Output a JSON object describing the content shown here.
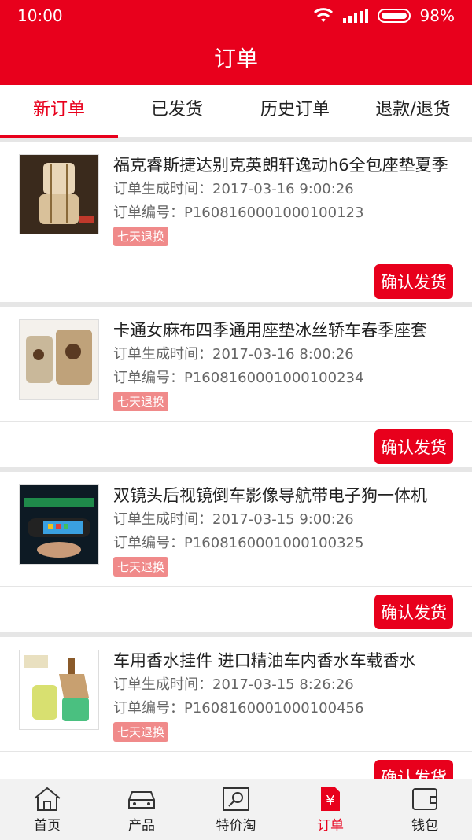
{
  "status": {
    "time": "10:00",
    "battery": "98%"
  },
  "header": {
    "title": "订单"
  },
  "tabs": [
    {
      "label": "新订单",
      "active": true
    },
    {
      "label": "已发货",
      "active": false
    },
    {
      "label": "历史订单",
      "active": false
    },
    {
      "label": "退款/退货",
      "active": false
    }
  ],
  "orders": [
    {
      "name": "福克睿斯捷达别克英朗轩逸动h6全包座垫夏季",
      "time_label": "订单生成时间：2017-03-16 9:00:26",
      "no_label": "订单编号：P160816000100010012 3",
      "tag": "七天退换",
      "button": "确认发货"
    },
    {
      "name": "卡通女麻布四季通用座垫冰丝轿车春季座套",
      "time_label": "订单生成时间：2017-03-16 8:00:26",
      "no_label": "订单编号：P1608160001000100234",
      "tag": "七天退换",
      "button": "确认发货"
    },
    {
      "name": "双镜头后视镜倒车影像导航带电子狗一体机",
      "time_label": "订单生成时间：2017-03-15 9:00:26",
      "no_label": "订单编号：P1608160001000100325",
      "tag": "七天退换",
      "button": "确认发货"
    },
    {
      "name": "车用香水挂件 进口精油车内香水车载香水",
      "time_label": "订单生成时间：2017-03-15 8:26:26",
      "no_label": "订单编号：P1608160001000100456",
      "tag": "七天退换",
      "button": "确认发货"
    }
  ],
  "tabbar": [
    {
      "label": "首页",
      "icon": "home-icon",
      "active": false
    },
    {
      "label": "产品",
      "icon": "car-icon",
      "active": false
    },
    {
      "label": "特价淘",
      "icon": "search-tag-icon",
      "active": false
    },
    {
      "label": "订单",
      "icon": "order-yen-icon",
      "active": true
    },
    {
      "label": "钱包",
      "icon": "wallet-icon",
      "active": false
    }
  ],
  "colors": {
    "brand": "#e8001c",
    "tag": "#f08a8a"
  }
}
